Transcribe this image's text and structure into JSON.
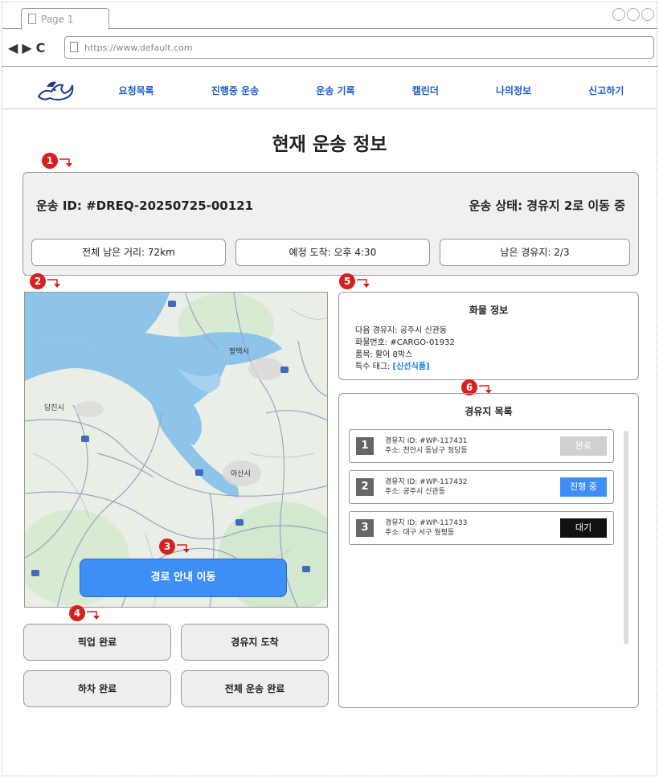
{
  "browser": {
    "tab_title": "Page 1",
    "url": "https://www.default.com"
  },
  "nav": {
    "items": [
      {
        "label": "요청목록"
      },
      {
        "label": "진행중 운송"
      },
      {
        "label": "운송 기록"
      },
      {
        "label": "캘린더"
      },
      {
        "label": "나의정보"
      },
      {
        "label": "신고하기"
      }
    ]
  },
  "page": {
    "title": "현재 운송 정보"
  },
  "markers": [
    "1",
    "2",
    "3",
    "4",
    "5",
    "6"
  ],
  "status": {
    "shipment_id": "운송 ID: #DREQ-20250725-00121",
    "shipment_status": "운송 상태: 경유지 2로 이동 중",
    "remaining_distance": "전체 남은 거리: 72km",
    "eta": "예정 도착: 오후 4:30",
    "remaining_stops": "남은 경유지: 2/3"
  },
  "map": {
    "labels": [
      "평택시",
      "당진시",
      "아산시"
    ],
    "route_button": "경로 안내 이동"
  },
  "actions": {
    "pickup": "픽업 완료",
    "waypoint_arrival": "경유지 도착",
    "dropoff": "하차 완료",
    "all_complete": "전체 운송 완료"
  },
  "cargo": {
    "title": "화물 정보",
    "next_stop": "다음 경유지: 공주시 신관동",
    "cargo_no": "화물번호: #CARGO-01932",
    "item": "품목: 활어 8박스",
    "special_tag_label": "특수 태그: ",
    "special_tag": "[신선식품]"
  },
  "waypoints": {
    "title": "경유지 목록",
    "items": [
      {
        "num": "1",
        "id": "경유지 ID:  #WP-117431",
        "address": "주소: 천안시 동남구 청당동",
        "status": "완료"
      },
      {
        "num": "2",
        "id": "경유지 ID:  #WP-117432",
        "address": "주소: 공주시 신관동",
        "status": "진행 중"
      },
      {
        "num": "3",
        "id": "경유지 ID:  #WP-117433",
        "address": "주소: 대구 서구 월평동",
        "status": "대기"
      }
    ]
  },
  "colors": {
    "primary": "#3d8ef5",
    "nav_link": "#1a5cc8",
    "marker": "#d62020"
  }
}
